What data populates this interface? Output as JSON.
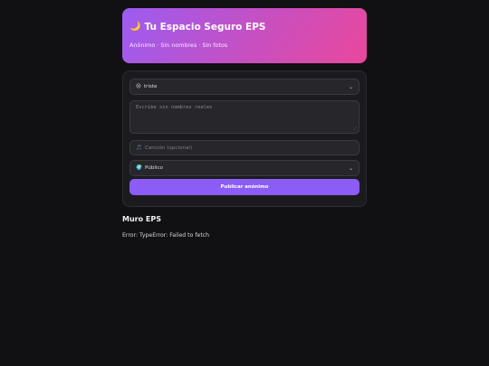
{
  "header": {
    "icon": "moon-icon",
    "emoji": "🌙",
    "title": "Tu Espacio Seguro EPS",
    "subtitle": "Anónimo · Sin nombres · Sin fotos"
  },
  "form": {
    "mood": {
      "emoji": "😢",
      "value": "triste"
    },
    "message": {
      "placeholder": "Escribe sin nombres reales"
    },
    "song": {
      "icon": "music-note-icon",
      "emoji": "🎵",
      "placeholder": "Canción (opcional)"
    },
    "visibility": {
      "emoji": "🌍",
      "value": "Público"
    },
    "submit_label": "Publicar anónimo"
  },
  "wall": {
    "title": "Muro EPS",
    "error": "Error: TypeError: Failed to fetch"
  },
  "colors": {
    "background": "#111113",
    "accent": "#8b5cf6",
    "gradient_start": "#9b5cf2",
    "gradient_end": "#e9489c"
  }
}
